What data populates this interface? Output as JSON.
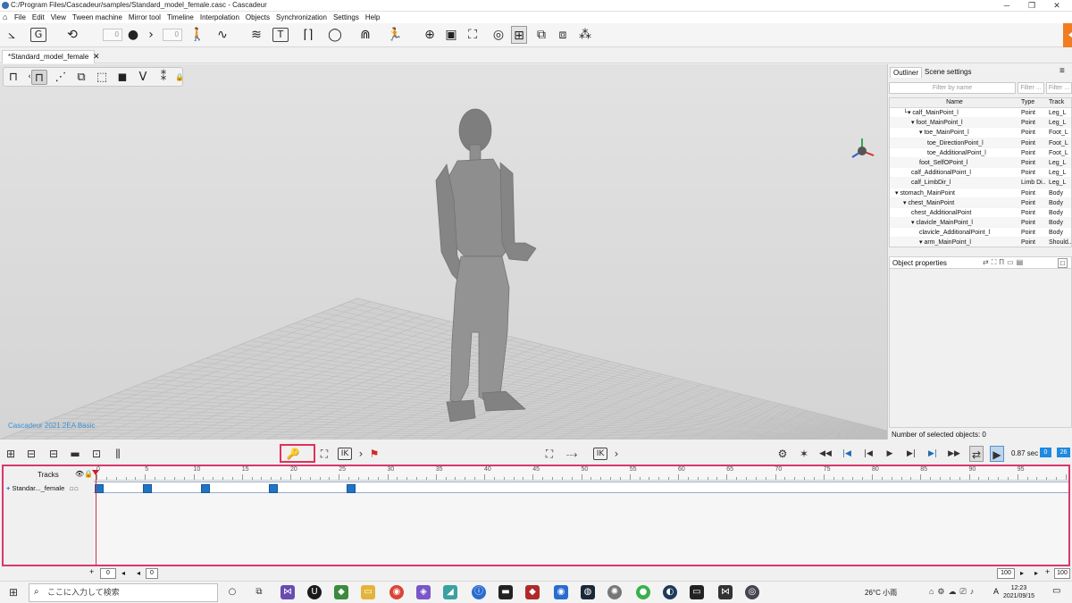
{
  "window": {
    "title": "C:/Program Files/Cascadeur/samples/Standard_model_female.casc - Cascadeur",
    "minimize": "─",
    "maximize": "❐",
    "close": "✕"
  },
  "menu": [
    "File",
    "Edit",
    "View",
    "Tween machine",
    "Mirror tool",
    "Timeline",
    "Interpolation",
    "Objects",
    "Synchronization",
    "Settings",
    "Help"
  ],
  "toolbar": {
    "frame_field_1": "0",
    "frame_field_2": "0",
    "icons": [
      "axes-tool-icon",
      "ghost-icon",
      "rotate-tool-icon",
      "key-dot-icon",
      "walk-icon",
      "spline-icon",
      "interpolation-icon",
      "tangent-icon",
      "bracket-icon",
      "loop-icon",
      "jump-icon",
      "run-icon",
      "target-icon",
      "camera-icon",
      "frame-icon",
      "spiral-icon",
      "grid-icon",
      "swap-icon",
      "copy-icon",
      "network-icon"
    ]
  },
  "document": {
    "tab": "*Standard_model_female",
    "tab_close": "✕"
  },
  "viewport": {
    "watermark": "Cascadeur 2021.2EA Basic"
  },
  "panel": {
    "tabs": [
      "Outliner",
      "Scene settings"
    ],
    "filter_placeholder": "Filter by name",
    "filter2": "Filter ...",
    "filter3": "Filter ...",
    "columns": [
      "Name",
      "Type",
      "Track"
    ],
    "rows": [
      {
        "name": "└▾ calf_MainPoint_l",
        "type": "Point",
        "track": "Leg_L",
        "indent": 1
      },
      {
        "name": "▾ foot_MainPoint_l",
        "type": "Point",
        "track": "Leg_L",
        "indent": 2
      },
      {
        "name": "▾ toe_MainPoint_l",
        "type": "Point",
        "track": "Foot_L",
        "indent": 3
      },
      {
        "name": "toe_DirectionPoint_l",
        "type": "Point",
        "track": "Foot_L",
        "indent": 4
      },
      {
        "name": "toe_AdditionalPoint_l",
        "type": "Point",
        "track": "Foot_L",
        "indent": 4
      },
      {
        "name": "foot_SelfOPoint_l",
        "type": "Point",
        "track": "Leg_L",
        "indent": 3
      },
      {
        "name": "calf_AdditionalPoint_l",
        "type": "Point",
        "track": "Leg_L",
        "indent": 2
      },
      {
        "name": "calf_LimbDir_l",
        "type": "Limb Di...",
        "track": "Leg_L",
        "indent": 2
      },
      {
        "name": "▾ stomach_MainPoint",
        "type": "Point",
        "track": "Body",
        "indent": 0
      },
      {
        "name": "▾ chest_MainPoint",
        "type": "Point",
        "track": "Body",
        "indent": 1
      },
      {
        "name": "chest_AdditionalPoint",
        "type": "Point",
        "track": "Body",
        "indent": 2
      },
      {
        "name": "▾ clavicle_MainPoint_l",
        "type": "Point",
        "track": "Body",
        "indent": 2
      },
      {
        "name": "clavicle_AdditionalPoint_l",
        "type": "Point",
        "track": "Body",
        "indent": 3
      },
      {
        "name": "▾ arm_MainPoint_l",
        "type": "Point",
        "track": "Should...",
        "indent": 3
      }
    ],
    "props_title": "Object properties",
    "selected": "Number of selected objects: 0"
  },
  "timeline": {
    "time": "0.87 sec",
    "field_a": "0",
    "field_b": "26",
    "tracks_label": "Tracks",
    "track_name": "Standar..._female",
    "ruler": [
      0,
      5,
      10,
      15,
      20,
      25,
      30,
      35,
      40,
      45,
      50,
      55,
      60,
      65,
      70,
      75,
      80,
      85,
      90,
      95
    ],
    "keyframes": [
      0,
      5,
      11,
      18,
      26
    ],
    "start": "0",
    "offset": "0",
    "end": "100",
    "end2": "100"
  },
  "taskbar": {
    "search": "ここに入力して検索",
    "weather": "26°C 小雨",
    "ime": "A",
    "time": "12:23",
    "date": "2021/09/15"
  }
}
